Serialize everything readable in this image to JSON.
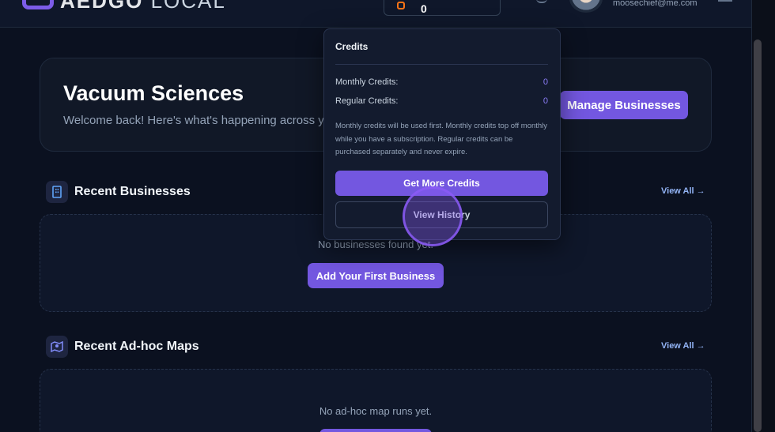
{
  "app": {
    "logo_text_bold": "AEDGO",
    "logo_text_light": "LOCAL"
  },
  "header": {
    "credit_count": "0",
    "user_email": "moosechief@me.com"
  },
  "hero": {
    "title": "Vacuum Sciences",
    "subtitle": "Welcome back! Here's what's happening across your businesses.",
    "manage_label": "Manage Businesses"
  },
  "businesses": {
    "title": "Recent Businesses",
    "view_all": "View All →",
    "empty_text": "No businesses found yet.",
    "add_label": "Add Your First Business"
  },
  "maps": {
    "title": "Recent Ad-hoc Maps",
    "view_all": "View All →",
    "empty_text": "No ad-hoc map runs yet."
  },
  "credits_dropdown": {
    "title": "Credits",
    "monthly_label": "Monthly Credits:",
    "monthly_value": "0",
    "regular_label": "Regular Credits:",
    "regular_value": "0",
    "note": "Monthly credits will be used first. Monthly credits top off monthly while you have a subscription. Regular credits can be purchased separately and never expire.",
    "get_more_label": "Get More Credits",
    "history_label": "View History"
  },
  "colors": {
    "accent": "#7357e0",
    "background": "#0b1120",
    "card": "#111827",
    "credit_value": "#8b7cf6",
    "link": "#93b4f5"
  }
}
